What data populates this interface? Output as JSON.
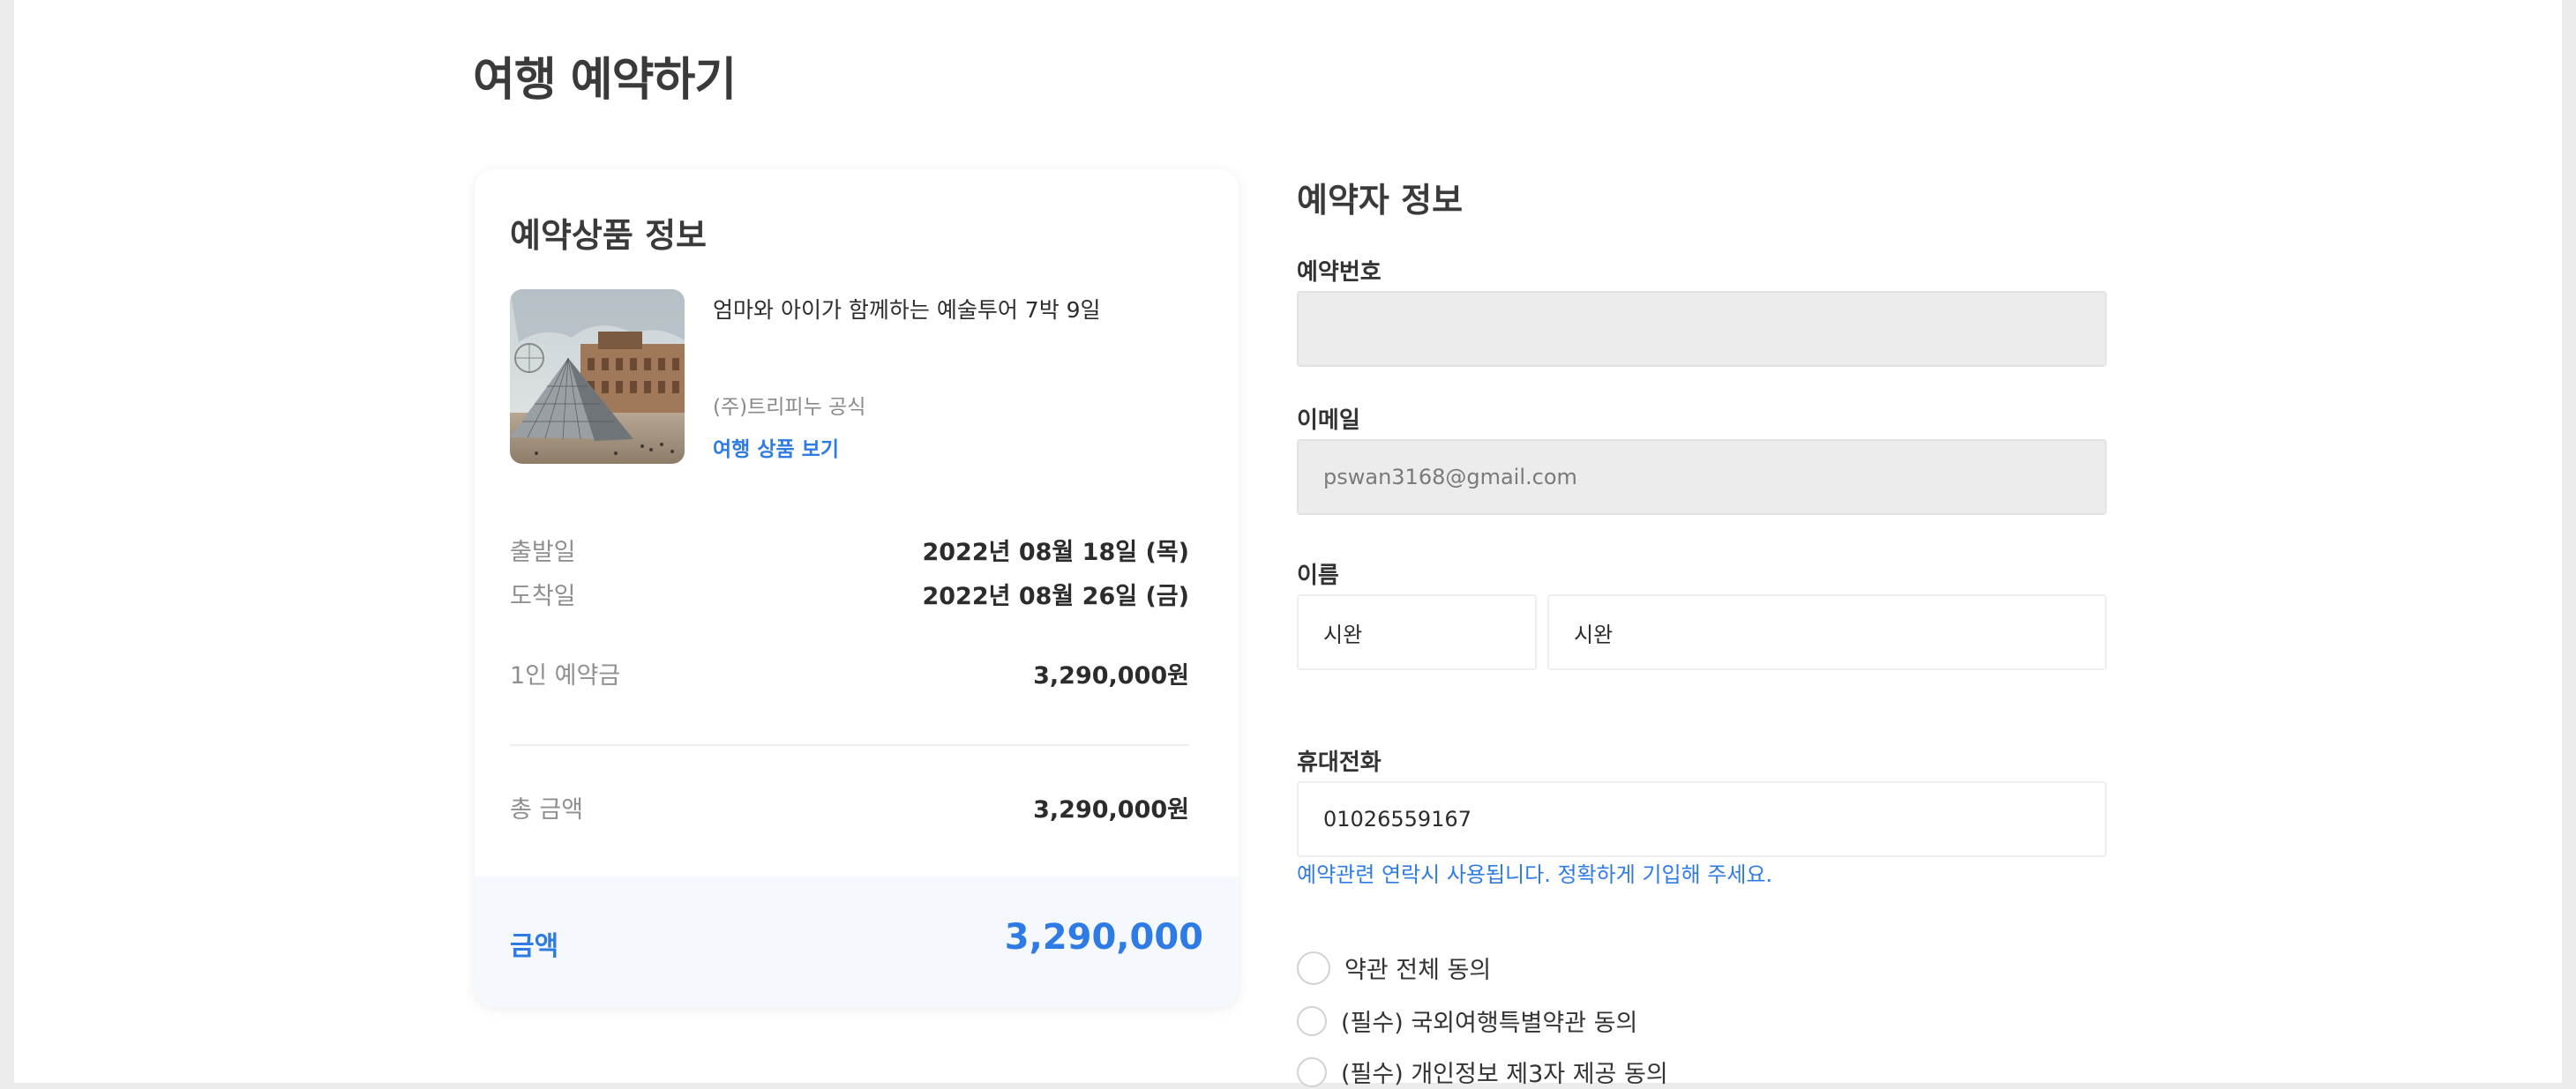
{
  "page": {
    "title": "여행 예약하기"
  },
  "product_card": {
    "title": "예약상품 정보",
    "image_icon": "louvre-photo",
    "product_name": "엄마와 아이가 함께하는 예술투어 7박 9일",
    "company": "(주)트리피누 공식",
    "link_label": "여행 상품 보기",
    "departure": {
      "label": "출발일",
      "value": "2022년 08월 18일 (목)"
    },
    "arrival": {
      "label": "도착일",
      "value": "2022년 08월 26일 (금)"
    },
    "per_person": {
      "label": "1인 예약금",
      "value": "3,290,000원"
    },
    "total": {
      "label": "총 금액",
      "value": "3,290,000원"
    },
    "amount": {
      "label": "금액",
      "value": "3,290,000"
    }
  },
  "booker": {
    "title": "예약자 정보",
    "reservation_no": {
      "label": "예약번호",
      "value": ""
    },
    "email": {
      "label": "이메일",
      "value": "pswan3168@gmail.com"
    },
    "name": {
      "label": "이름",
      "last": "시완",
      "first": "시완"
    },
    "phone": {
      "label": "휴대전화",
      "value": "01026559167",
      "hint": "예약관련 연락시 사용됩니다. 정확하게 기입해 주세요."
    }
  },
  "agreements": [
    {
      "label": "약관 전체 동의"
    },
    {
      "label": "(필수) 국외여행특별약관 동의"
    },
    {
      "label": "(필수) 개인정보 제3자 제공 동의"
    }
  ],
  "colors": {
    "accent": "#2f7be5",
    "disabled_bg": "#ececec",
    "footer_bg": "#f5f8fd"
  }
}
